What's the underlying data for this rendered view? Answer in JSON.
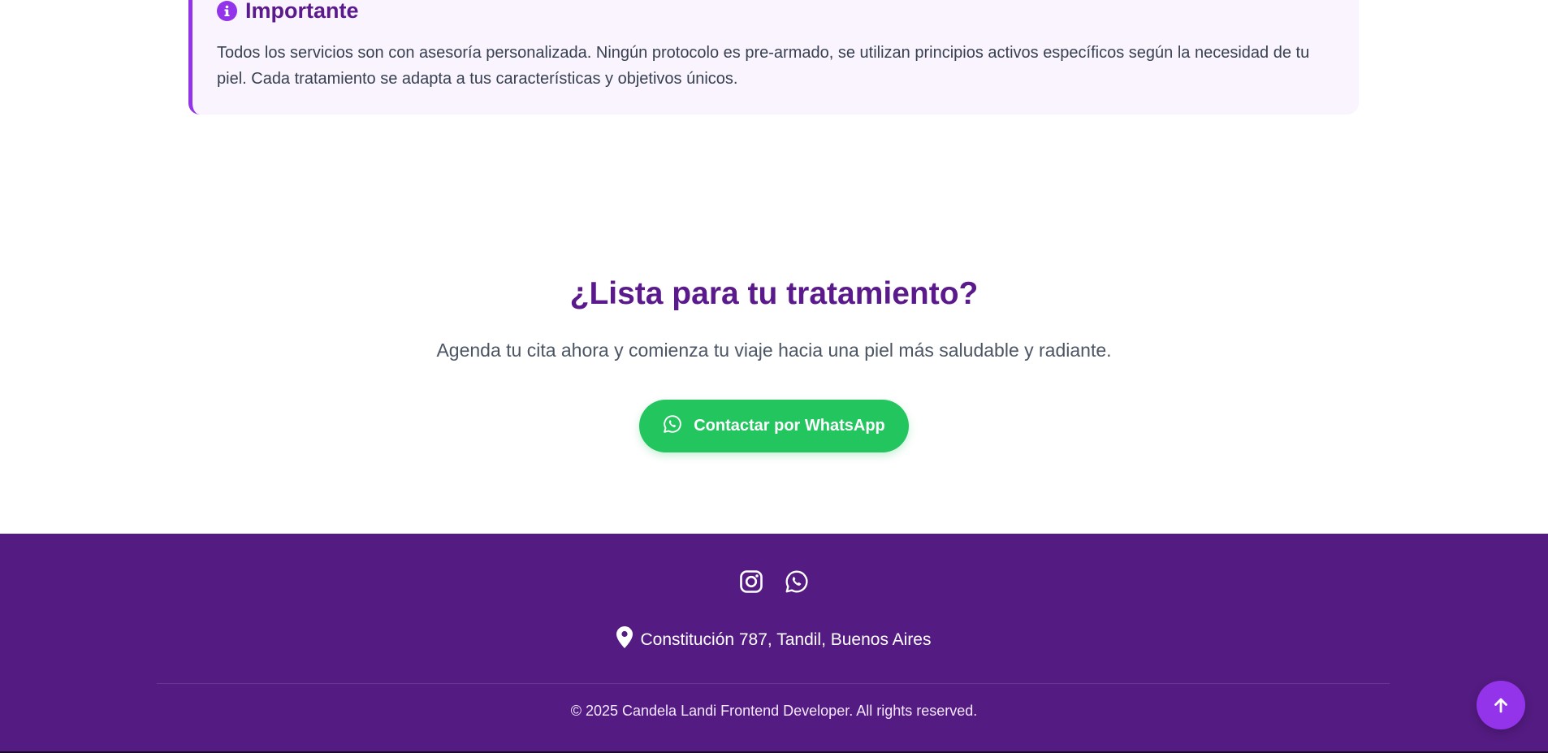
{
  "note": {
    "icon": "info-icon",
    "title": "Importante",
    "text": "Todos los servicios son con asesoría personalizada. Ningún protocolo es pre-armado, se utilizan principios activos específicos según la necesidad de tu piel. Cada tratamiento se adapta a tus características y objetivos únicos."
  },
  "cta": {
    "title": "¿Lista para tu tratamiento?",
    "subtitle": "Agenda tu cita ahora y comienza tu viaje hacia una piel más saludable y radiante.",
    "button_label": "Contactar por WhatsApp",
    "button_icon": "whatsapp-icon"
  },
  "footer": {
    "social": [
      {
        "icon": "instagram-icon"
      },
      {
        "icon": "whatsapp-icon"
      }
    ],
    "address_icon": "map-pin-icon",
    "address": "Constitución 787, Tandil, Buenos Aires",
    "copyright": "© 2025 Candela Landi Frontend Developer. All rights reserved."
  },
  "back_to_top": {
    "icon": "arrow-up-icon"
  },
  "colors": {
    "primary_dark": "#541b82",
    "accent": "#9333ea",
    "whatsapp_green": "#22c55e",
    "note_bg": "#faf4fe"
  }
}
